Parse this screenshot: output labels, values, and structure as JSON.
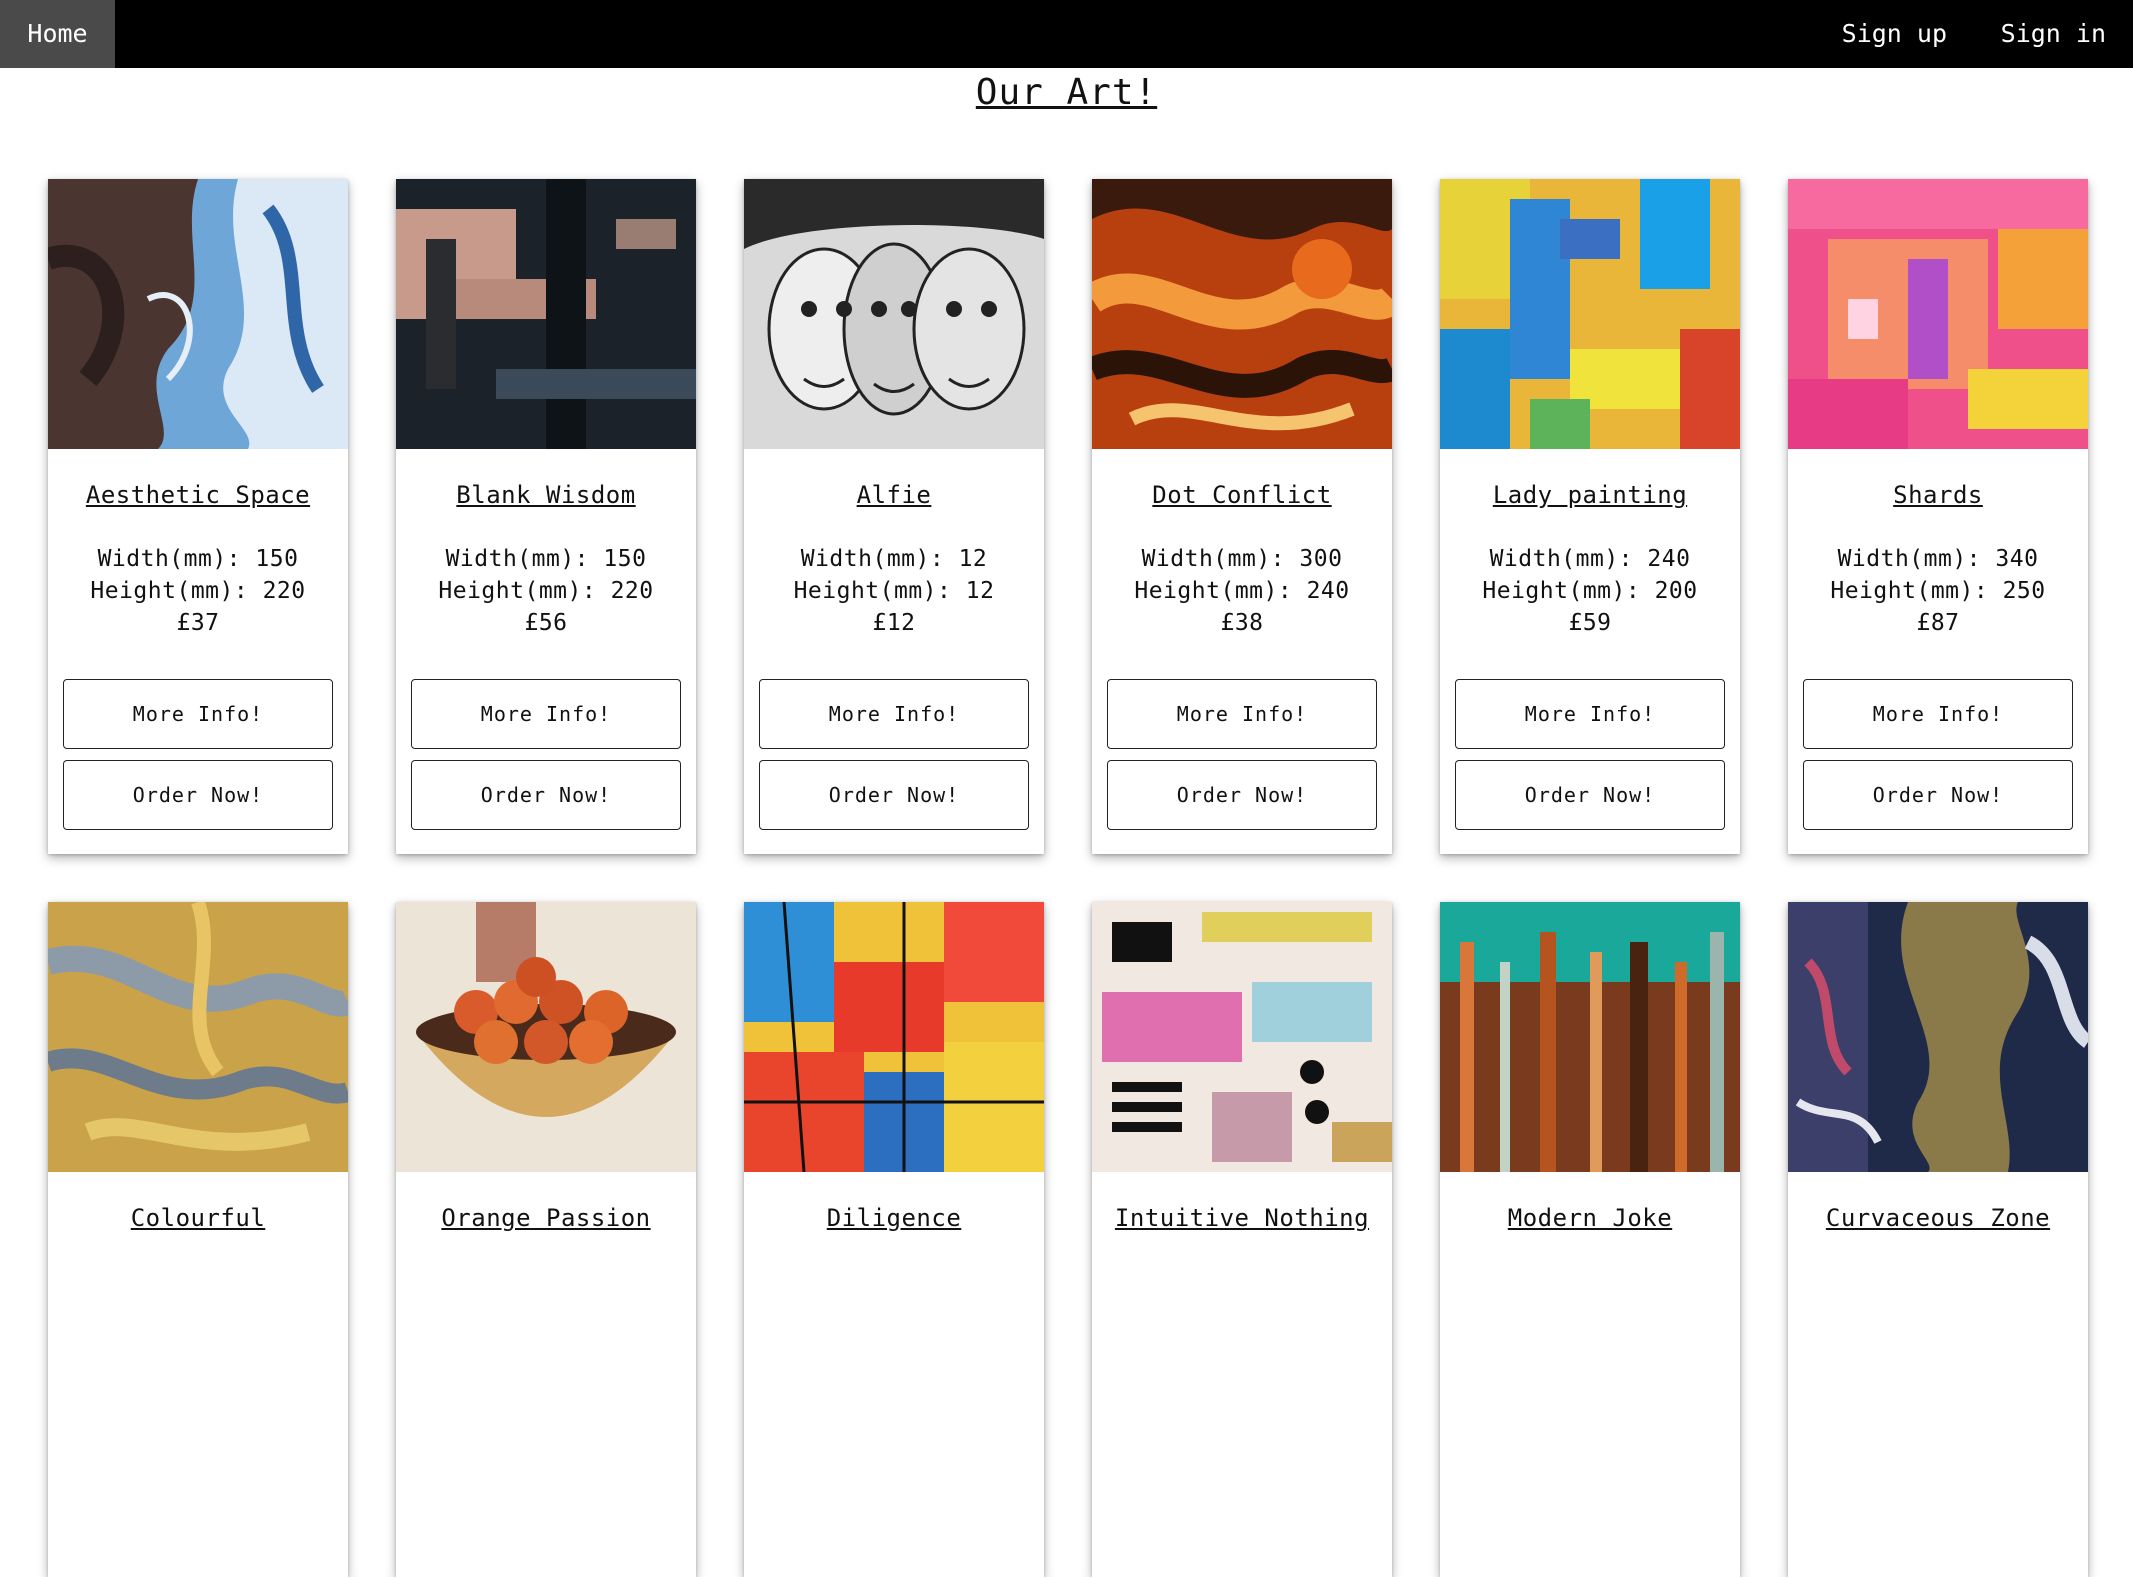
{
  "nav": {
    "home": "Home",
    "sign_up": "Sign up",
    "sign_in": "Sign in"
  },
  "page": {
    "title": "Our Art!"
  },
  "labels": {
    "width": "Width(mm): ",
    "height": "Height(mm): ",
    "more_info": "More Info!",
    "order_now": "Order Now!"
  },
  "artworks": [
    {
      "title": "Aesthetic Space",
      "width": "150",
      "height": "220",
      "price": "£37"
    },
    {
      "title": "Blank Wisdom",
      "width": "150",
      "height": "220",
      "price": "£56"
    },
    {
      "title": "Alfie",
      "width": "12",
      "height": "12",
      "price": "£12"
    },
    {
      "title": "Dot Conflict",
      "width": "300",
      "height": "240",
      "price": "£38"
    },
    {
      "title": "Lady painting",
      "width": "240",
      "height": "200",
      "price": "£59"
    },
    {
      "title": "Shards",
      "width": "340",
      "height": "250",
      "price": "£87"
    },
    {
      "title": "Colourful"
    },
    {
      "title": "Orange Passion"
    },
    {
      "title": "Diligence"
    },
    {
      "title": "Intuitive Nothing"
    },
    {
      "title": "Modern Joke"
    },
    {
      "title": "Curvaceous Zone"
    }
  ]
}
